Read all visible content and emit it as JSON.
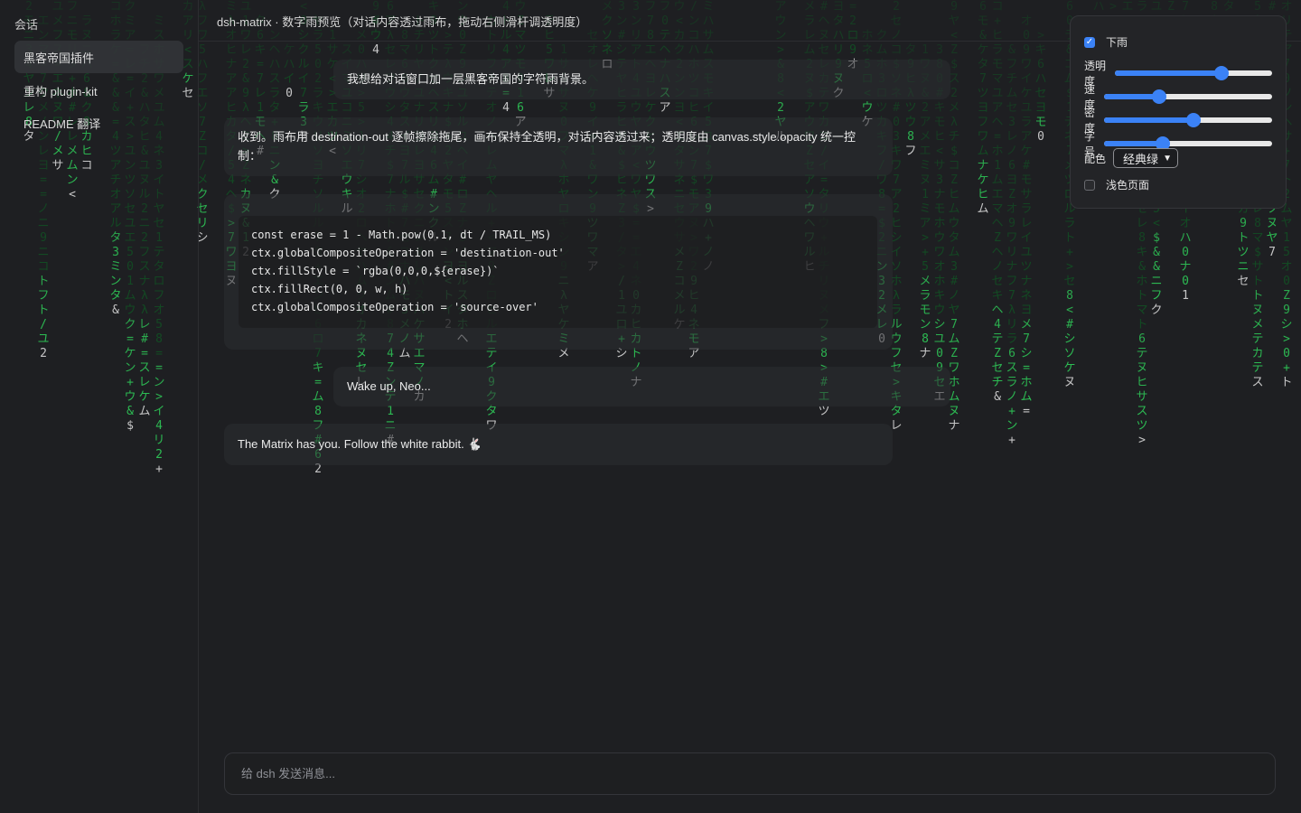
{
  "sidebar": {
    "title": "会话",
    "conversations": [
      {
        "label": "黑客帝国插件",
        "active": true
      },
      {
        "label": "重构 plugin-kit",
        "active": false
      },
      {
        "label": "README 翻译",
        "active": false
      }
    ]
  },
  "header": {
    "title": "dsh-matrix · 数字雨预览（对话内容透过雨布，拖动右侧滑杆调透明度）"
  },
  "messages": [
    {
      "role": "user",
      "text": "我想给对话窗口加一层黑客帝国的字符雨背景。"
    },
    {
      "role": "assistant",
      "text": "收到。雨布用 destination-out 逐帧擦除拖尾，画布保持全透明，对话内容透过来；透明度由 canvas.style.opacity 统一控制："
    },
    {
      "role": "assistant-code",
      "lines": [
        "const erase = 1 - Math.pow(0.1, dt / TRAIL_MS)",
        "ctx.globalCompositeOperation = 'destination-out'",
        "ctx.fillStyle = `rgba(0,0,0,${erase})`",
        "ctx.fillRect(0, 0, w, h)",
        "ctx.globalCompositeOperation = 'source-over'"
      ]
    },
    {
      "role": "user",
      "text": "Wake up, Neo..."
    },
    {
      "role": "assistant",
      "text": "The Matrix has you. Follow the white rabbit. 🐇"
    }
  ],
  "composer": {
    "placeholder": "给 dsh 发送消息..."
  },
  "panel": {
    "rain": {
      "label": "下雨",
      "checked": true
    },
    "sliders": [
      {
        "label": "透明度",
        "value": 0.68
      },
      {
        "label": "速度",
        "value": 0.33
      },
      {
        "label": "密度",
        "value": 0.53
      },
      {
        "label": "字号",
        "value": 0.35
      }
    ],
    "palette": {
      "label": "配色",
      "selected": "经典绿"
    },
    "light_page": {
      "label": "浅色页面",
      "checked": false
    }
  },
  "colors": {
    "rain_head": "#2fd25a",
    "rain_tail": "#0f5a24",
    "accent": "#3b82f6",
    "background": "#1e1f22"
  },
  "rain_glyphs": "アイウエオカキクケコサシスセソタチツテトナニヌネノハヒフヘホマミムメモヤユヨラリルレロワン0123456789$#&+=/<>Zλ"
}
